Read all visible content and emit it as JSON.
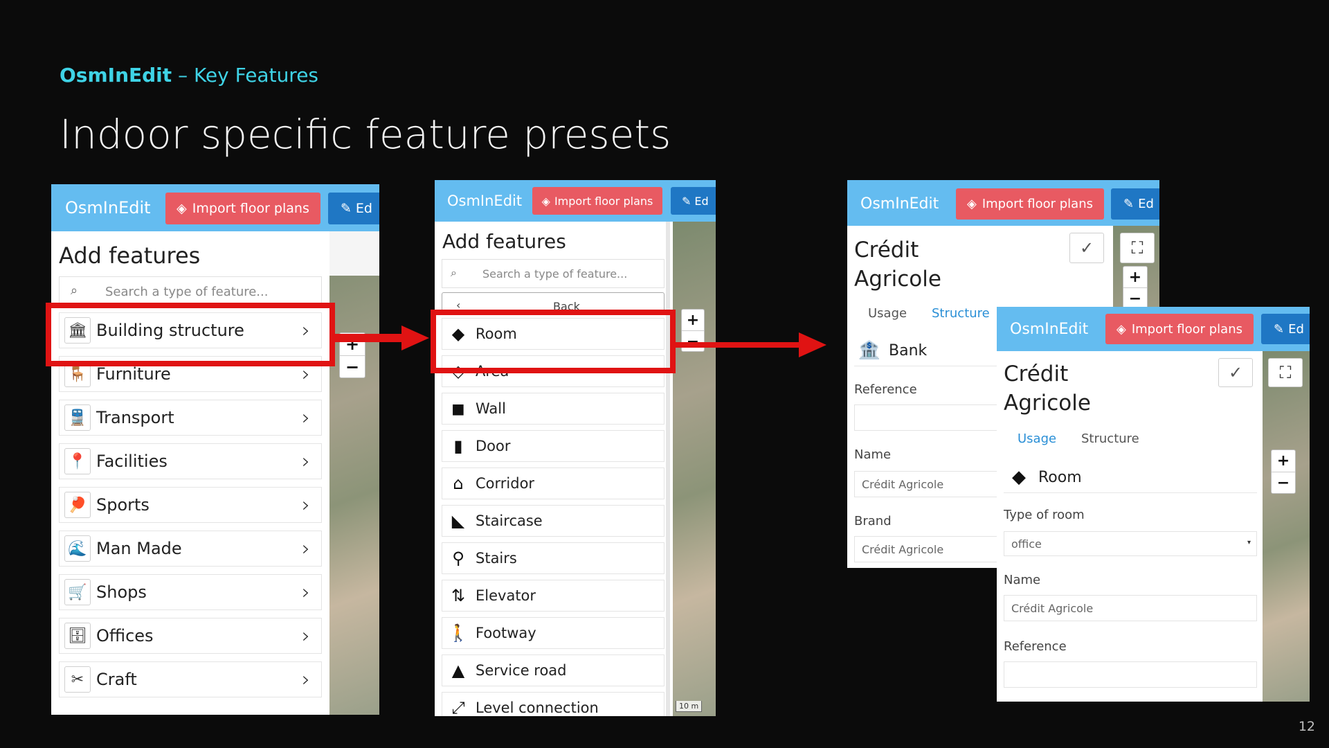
{
  "slide": {
    "subtitle_brand": "OsmInEdit",
    "subtitle_rest": "– Key Features",
    "title": "Indoor specific feature presets",
    "page_number": "12"
  },
  "app": {
    "brand": "OsmInEdit",
    "import_label": "Import floor plans",
    "edit_label": "Ed",
    "zoom_in": "+",
    "zoom_out": "−"
  },
  "panel1": {
    "title": "Add features",
    "search_placeholder": "Search a type of feature...",
    "chevron": "›",
    "categories": [
      {
        "label": "Building structure",
        "icon": "building-icon",
        "glyph": "🏛"
      },
      {
        "label": "Furniture",
        "icon": "chair-icon",
        "glyph": "🪑"
      },
      {
        "label": "Transport",
        "icon": "train-icon",
        "glyph": "🚆"
      },
      {
        "label": "Facilities",
        "icon": "location-pin-icon",
        "glyph": "📍"
      },
      {
        "label": "Sports",
        "icon": "table-tennis-icon",
        "glyph": "🏓"
      },
      {
        "label": "Man Made",
        "icon": "pier-icon",
        "glyph": "🌊"
      },
      {
        "label": "Shops",
        "icon": "shopping-cart-icon",
        "glyph": "🛒"
      },
      {
        "label": "Offices",
        "icon": "office-desk-icon",
        "glyph": "🗄"
      },
      {
        "label": "Craft",
        "icon": "tools-icon",
        "glyph": "✂"
      }
    ]
  },
  "panel2": {
    "title": "Add features",
    "search_placeholder": "Search a type of feature...",
    "back_label": "Back",
    "back_chevron": "‹",
    "scale_label": "10 m",
    "presets": [
      {
        "label": "Room",
        "icon": "room-icon",
        "glyph": "◆"
      },
      {
        "label": "Area",
        "icon": "area-icon",
        "glyph": "◇"
      },
      {
        "label": "Wall",
        "icon": "wall-icon",
        "glyph": "◼"
      },
      {
        "label": "Door",
        "icon": "door-icon",
        "glyph": "▮"
      },
      {
        "label": "Corridor",
        "icon": "corridor-icon",
        "glyph": "⌂"
      },
      {
        "label": "Staircase",
        "icon": "staircase-icon",
        "glyph": "◣"
      },
      {
        "label": "Stairs",
        "icon": "stairs-icon",
        "glyph": "⚲"
      },
      {
        "label": "Elevator",
        "icon": "elevator-icon",
        "glyph": "⇅"
      },
      {
        "label": "Footway",
        "icon": "pedestrian-icon",
        "glyph": "🚶"
      },
      {
        "label": "Service road",
        "icon": "road-icon",
        "glyph": "▲"
      },
      {
        "label": "Level connection",
        "icon": "level-connection-icon",
        "glyph": "⤢"
      }
    ]
  },
  "panel3": {
    "title_line1": "Crédit",
    "title_line2": "Agricole",
    "tab_usage": "Usage",
    "tab_structure": "Structure",
    "preset_label": "Bank",
    "preset_glyph": "🏦",
    "reference_label": "Reference",
    "reference_value": "",
    "name_label": "Name",
    "name_value": "Crédit Agricole",
    "brand_label": "Brand",
    "brand_value": "Crédit Agricole",
    "check_glyph": "✓",
    "select_area_glyph": "⛶"
  },
  "panel4": {
    "title_line1": "Crédit",
    "title_line2": "Agricole",
    "tab_usage": "Usage",
    "tab_structure": "Structure",
    "preset_label": "Room",
    "preset_glyph": "◆",
    "type_label": "Type of room",
    "type_value": "office",
    "name_label": "Name",
    "name_value": "Crédit Agricole",
    "reference_label": "Reference",
    "reference_value": "",
    "check_glyph": "✓",
    "select_area_glyph": "⛶"
  },
  "colors": {
    "appbar": "#64bcf0",
    "import_button": "#e85a62",
    "edit_button": "#1f77c4",
    "highlight": "#e01313",
    "slide_background": "#0b0b0b",
    "subtitle": "#3fd3e6"
  }
}
